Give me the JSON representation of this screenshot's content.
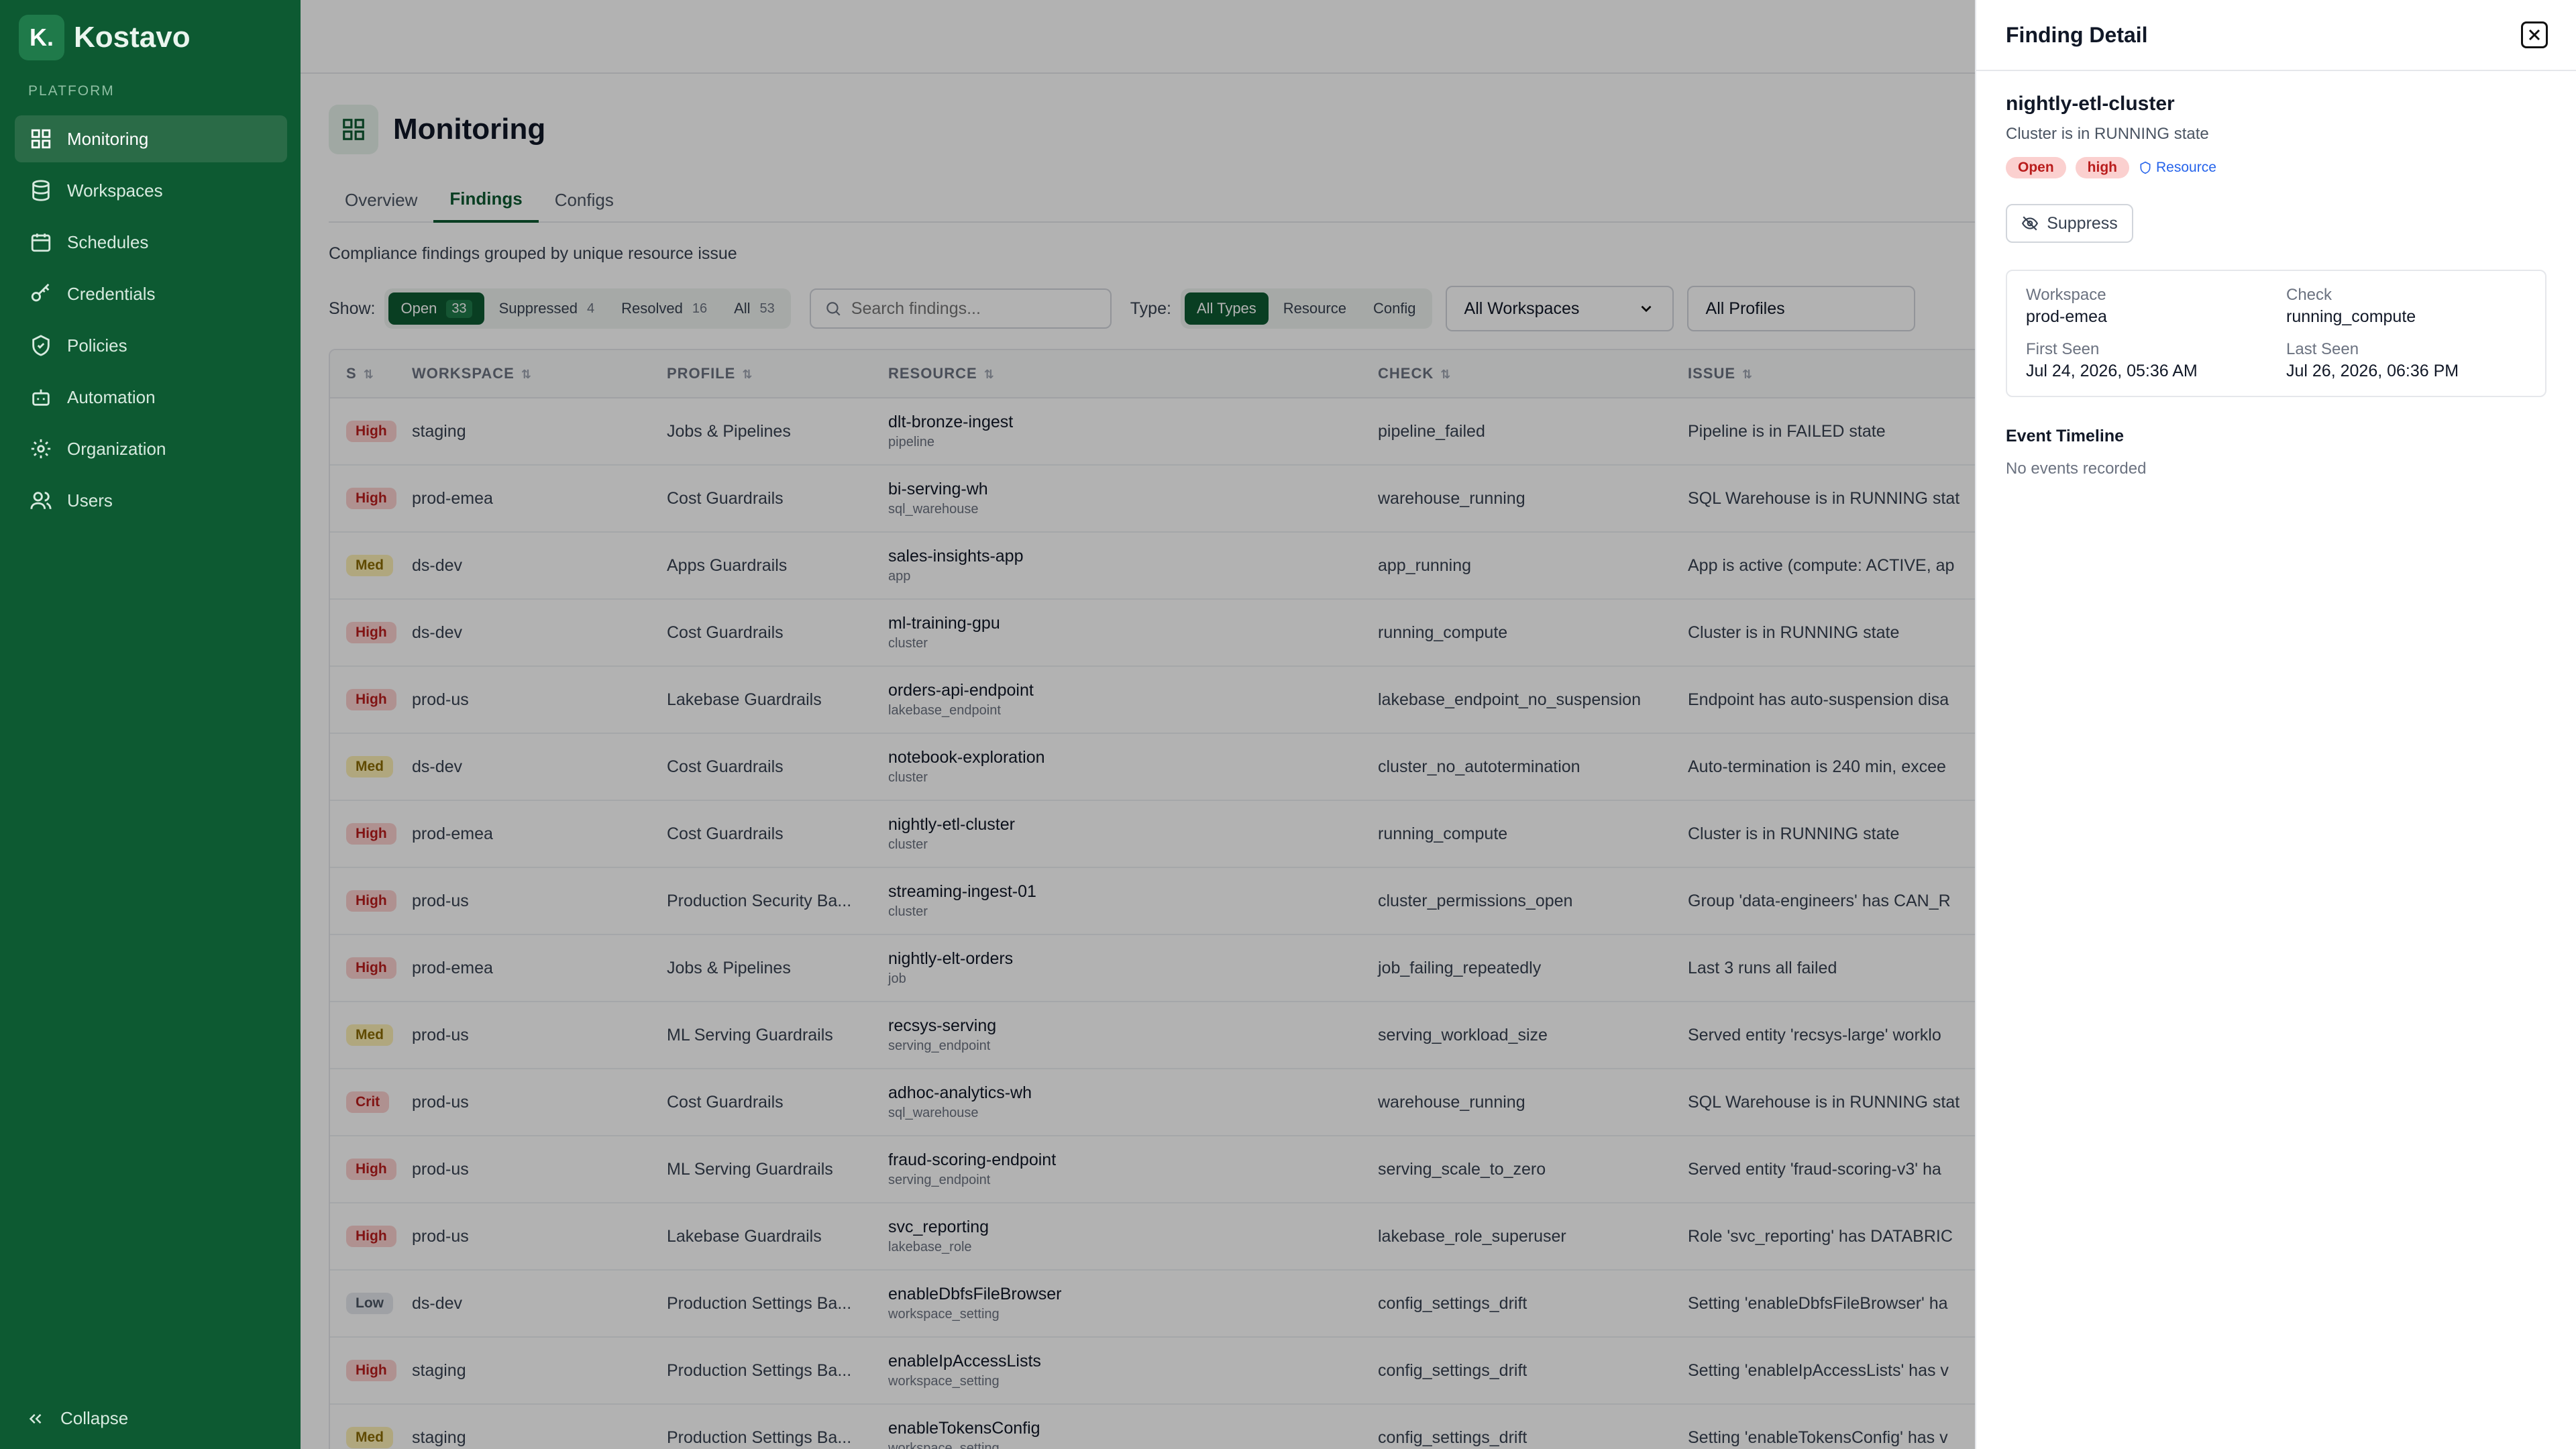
{
  "brand": {
    "logo_letter": "K.",
    "name": "Kostavo",
    "section": "PLATFORM"
  },
  "nav": [
    {
      "label": "Monitoring",
      "icon": "grid-icon",
      "active": true
    },
    {
      "label": "Workspaces",
      "icon": "database-icon"
    },
    {
      "label": "Schedules",
      "icon": "calendar-icon"
    },
    {
      "label": "Credentials",
      "icon": "key-icon"
    },
    {
      "label": "Policies",
      "icon": "shield-icon"
    },
    {
      "label": "Automation",
      "icon": "bot-icon"
    },
    {
      "label": "Organization",
      "icon": "gear-icon"
    },
    {
      "label": "Users",
      "icon": "users-icon"
    }
  ],
  "collapse_label": "Collapse",
  "page": {
    "title": "Monitoring",
    "tabs": [
      "Overview",
      "Findings",
      "Configs"
    ],
    "active_tab": "Findings",
    "subtitle": "Compliance findings grouped by unique resource issue"
  },
  "filters": {
    "show_label": "Show:",
    "status": [
      {
        "label": "Open",
        "count": "33",
        "active": true
      },
      {
        "label": "Suppressed",
        "count": "4"
      },
      {
        "label": "Resolved",
        "count": "16"
      },
      {
        "label": "All",
        "count": "53"
      }
    ],
    "search_placeholder": "Search findings...",
    "type_label": "Type:",
    "types": [
      {
        "label": "All Types",
        "active": true
      },
      {
        "label": "Resource"
      },
      {
        "label": "Config"
      }
    ],
    "workspace_select": "All Workspaces",
    "profile_select": "All Profiles"
  },
  "table": {
    "columns": [
      "S",
      "WORKSPACE",
      "PROFILE",
      "RESOURCE",
      "CHECK",
      "ISSUE"
    ],
    "rows": [
      {
        "sev": "High",
        "ws": "staging",
        "profile": "Jobs & Pipelines",
        "res": "dlt-bronze-ingest",
        "rtype": "pipeline",
        "check": "pipeline_failed",
        "issue": "Pipeline is in FAILED state"
      },
      {
        "sev": "High",
        "ws": "prod-emea",
        "profile": "Cost Guardrails",
        "res": "bi-serving-wh",
        "rtype": "sql_warehouse",
        "check": "warehouse_running",
        "issue": "SQL Warehouse is in RUNNING stat"
      },
      {
        "sev": "Med",
        "ws": "ds-dev",
        "profile": "Apps Guardrails",
        "res": "sales-insights-app",
        "rtype": "app",
        "check": "app_running",
        "issue": "App is active (compute: ACTIVE, ap"
      },
      {
        "sev": "High",
        "ws": "ds-dev",
        "profile": "Cost Guardrails",
        "res": "ml-training-gpu",
        "rtype": "cluster",
        "check": "running_compute",
        "issue": "Cluster is in RUNNING state"
      },
      {
        "sev": "High",
        "ws": "prod-us",
        "profile": "Lakebase Guardrails",
        "res": "orders-api-endpoint",
        "rtype": "lakebase_endpoint",
        "check": "lakebase_endpoint_no_suspension",
        "issue": "Endpoint has auto-suspension disa"
      },
      {
        "sev": "Med",
        "ws": "ds-dev",
        "profile": "Cost Guardrails",
        "res": "notebook-exploration",
        "rtype": "cluster",
        "check": "cluster_no_autotermination",
        "issue": "Auto-termination is 240 min, excee"
      },
      {
        "sev": "High",
        "ws": "prod-emea",
        "profile": "Cost Guardrails",
        "res": "nightly-etl-cluster",
        "rtype": "cluster",
        "check": "running_compute",
        "issue": "Cluster is in RUNNING state"
      },
      {
        "sev": "High",
        "ws": "prod-us",
        "profile": "Production Security Ba...",
        "res": "streaming-ingest-01",
        "rtype": "cluster",
        "check": "cluster_permissions_open",
        "issue": "Group 'data-engineers' has CAN_R"
      },
      {
        "sev": "High",
        "ws": "prod-emea",
        "profile": "Jobs & Pipelines",
        "res": "nightly-elt-orders",
        "rtype": "job",
        "check": "job_failing_repeatedly",
        "issue": "Last 3 runs all failed"
      },
      {
        "sev": "Med",
        "ws": "prod-us",
        "profile": "ML Serving Guardrails",
        "res": "recsys-serving",
        "rtype": "serving_endpoint",
        "check": "serving_workload_size",
        "issue": "Served entity 'recsys-large' worklo"
      },
      {
        "sev": "Crit",
        "ws": "prod-us",
        "profile": "Cost Guardrails",
        "res": "adhoc-analytics-wh",
        "rtype": "sql_warehouse",
        "check": "warehouse_running",
        "issue": "SQL Warehouse is in RUNNING stat"
      },
      {
        "sev": "High",
        "ws": "prod-us",
        "profile": "ML Serving Guardrails",
        "res": "fraud-scoring-endpoint",
        "rtype": "serving_endpoint",
        "check": "serving_scale_to_zero",
        "issue": "Served entity 'fraud-scoring-v3' ha"
      },
      {
        "sev": "High",
        "ws": "prod-us",
        "profile": "Lakebase Guardrails",
        "res": "svc_reporting",
        "rtype": "lakebase_role",
        "check": "lakebase_role_superuser",
        "issue": "Role 'svc_reporting' has DATABRIC"
      },
      {
        "sev": "Low",
        "ws": "ds-dev",
        "profile": "Production Settings Ba...",
        "res": "enableDbfsFileBrowser",
        "rtype": "workspace_setting",
        "check": "config_settings_drift",
        "issue": "Setting 'enableDbfsFileBrowser' ha"
      },
      {
        "sev": "High",
        "ws": "staging",
        "profile": "Production Settings Ba...",
        "res": "enableIpAccessLists",
        "rtype": "workspace_setting",
        "check": "config_settings_drift",
        "issue": "Setting 'enableIpAccessLists' has v"
      },
      {
        "sev": "Med",
        "ws": "staging",
        "profile": "Production Settings Ba...",
        "res": "enableTokensConfig",
        "rtype": "workspace_setting",
        "check": "config_settings_drift",
        "issue": "Setting 'enableTokensConfig' has v"
      }
    ]
  },
  "detail": {
    "title": "Finding Detail",
    "resource": "nightly-etl-cluster",
    "description": "Cluster is in RUNNING state",
    "status_pill": "Open",
    "severity_pill": "high",
    "resource_link": "Resource",
    "suppress_label": "Suppress",
    "fields": [
      {
        "key": "Workspace",
        "value": "prod-emea"
      },
      {
        "key": "Check",
        "value": "running_compute"
      },
      {
        "key": "First Seen",
        "value": "Jul 24, 2026, 05:36 AM"
      },
      {
        "key": "Last Seen",
        "value": "Jul 26, 2026, 06:36 PM"
      }
    ],
    "timeline_title": "Event Timeline",
    "timeline_empty": "No events recorded"
  }
}
